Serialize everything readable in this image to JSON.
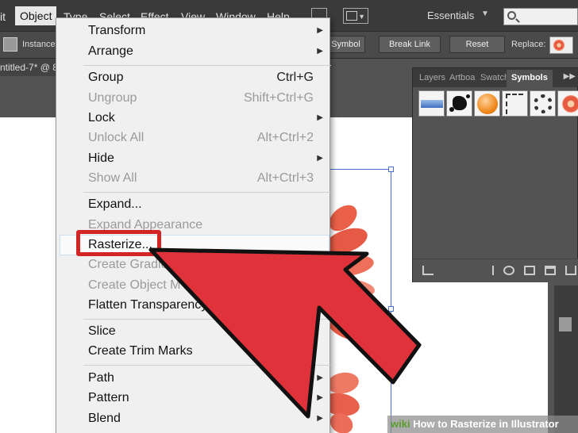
{
  "menubar": {
    "items": [
      "it",
      "Object",
      "Type",
      "Select",
      "Effect",
      "View",
      "Window",
      "Help"
    ],
    "workspace": "Essentials",
    "search_placeholder": ""
  },
  "controlbar": {
    "instance_label": "Instance",
    "symbol_btn": "Symbol",
    "break_link_btn": "Break Link",
    "reset_btn": "Reset",
    "replace_label": "Replace:"
  },
  "document": {
    "tab_label": "ntitled-7* @ 8"
  },
  "panel": {
    "tabs": [
      "Layers",
      "Artboa",
      "Swatch",
      "Symbols"
    ],
    "active_tab": "Symbols",
    "symbols": [
      "blue-bar",
      "ink-splat",
      "orange-button",
      "dashed-frame",
      "ring-wreath",
      "flower"
    ]
  },
  "object_menu": {
    "items": [
      {
        "label": "Transform",
        "shortcut": "",
        "enabled": true,
        "submenu": true
      },
      {
        "label": "Arrange",
        "shortcut": "",
        "enabled": true,
        "submenu": true
      },
      {
        "label": "Group",
        "shortcut": "Ctrl+G",
        "enabled": true,
        "submenu": false
      },
      {
        "label": "Ungroup",
        "shortcut": "Shift+Ctrl+G",
        "enabled": false,
        "submenu": false
      },
      {
        "label": "Lock",
        "shortcut": "",
        "enabled": true,
        "submenu": true
      },
      {
        "label": "Unlock All",
        "shortcut": "Alt+Ctrl+2",
        "enabled": false,
        "submenu": false
      },
      {
        "label": "Hide",
        "shortcut": "",
        "enabled": true,
        "submenu": true
      },
      {
        "label": "Show All",
        "shortcut": "Alt+Ctrl+3",
        "enabled": false,
        "submenu": false
      },
      {
        "label": "Expand...",
        "shortcut": "",
        "enabled": true,
        "submenu": false
      },
      {
        "label": "Expand Appearance",
        "shortcut": "",
        "enabled": false,
        "submenu": false
      },
      {
        "label": "Rasterize...",
        "shortcut": "",
        "enabled": true,
        "submenu": false
      },
      {
        "label": "Create Gradie",
        "shortcut": "",
        "enabled": false,
        "submenu": false
      },
      {
        "label": "Create Object M",
        "shortcut": "",
        "enabled": false,
        "submenu": false
      },
      {
        "label": "Flatten Transparency",
        "shortcut": "",
        "enabled": true,
        "submenu": false
      },
      {
        "label": "Slice",
        "shortcut": "",
        "enabled": true,
        "submenu": true
      },
      {
        "label": "Create Trim Marks",
        "shortcut": "",
        "enabled": true,
        "submenu": false
      },
      {
        "label": "Path",
        "shortcut": "",
        "enabled": true,
        "submenu": true
      },
      {
        "label": "Pattern",
        "shortcut": "",
        "enabled": true,
        "submenu": true
      },
      {
        "label": "Blend",
        "shortcut": "",
        "enabled": true,
        "submenu": true
      }
    ]
  },
  "watermark": {
    "brand": "wiki",
    "text": "How to Rasterize in Illustrator"
  },
  "colors": {
    "arrow_fill": "#e0323a",
    "highlight_border": "#d42525",
    "petal": "#e8604c",
    "menu_bg": "#f0f0f0"
  }
}
